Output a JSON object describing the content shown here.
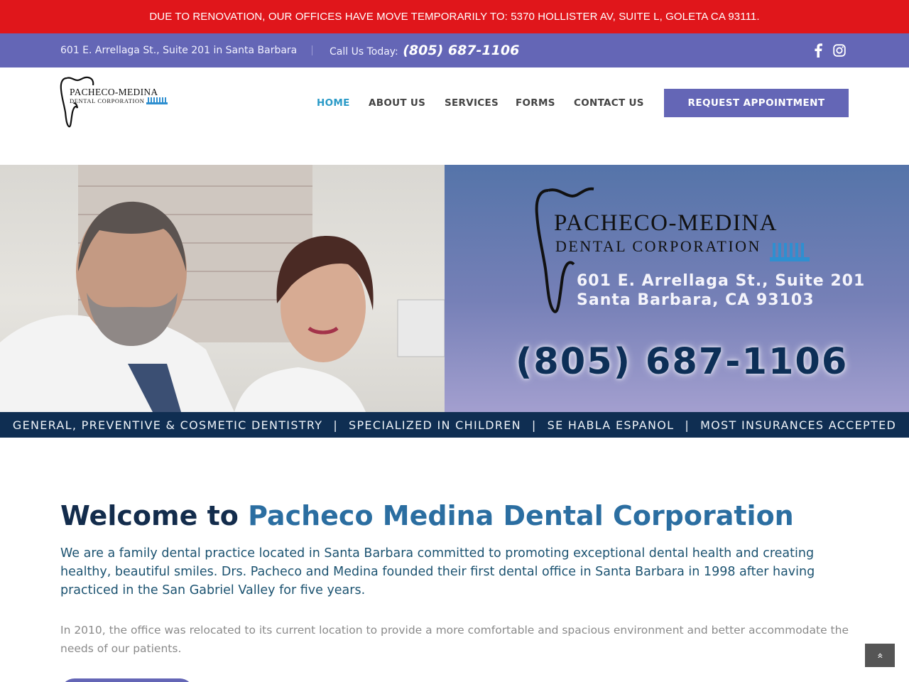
{
  "alert": {
    "text": "DUE TO RENOVATION, OUR OFFICES HAVE MOVE TEMPORARILY TO: 5370 HOLLISTER AV, SUITE L, GOLETA CA 93111."
  },
  "topbar": {
    "address": "601 E. Arrellaga St., Suite 201 in Santa Barbara",
    "call_label": "Call Us Today:",
    "phone": "(805) 687-1106",
    "social": [
      "facebook-icon",
      "instagram-icon"
    ]
  },
  "header": {
    "logo_title": "PACHECO-MEDINA",
    "logo_subtitle": "DENTAL CORPORATION",
    "nav": [
      {
        "label": "HOME",
        "active": true
      },
      {
        "label": "ABOUT US",
        "active": false
      },
      {
        "label": "SERVICES",
        "active": false
      },
      {
        "label": "FORMS",
        "active": false
      },
      {
        "label": "CONTACT US",
        "active": false
      }
    ],
    "cta_label": "REQUEST APPOINTMENT"
  },
  "hero": {
    "brand_title": "PACHECO-MEDINA",
    "brand_subtitle": "DENTAL CORPORATION",
    "address_line1": "601 E. Arrellaga St., Suite 201",
    "address_line2": "Santa Barbara, CA 93103",
    "phone": "(805) 687-1106"
  },
  "services_strip": {
    "items": [
      "GENERAL, PREVENTIVE & COSMETIC DENTISTRY",
      "SPECIALIZED IN CHILDREN",
      "SE HABLA ESPANOL",
      "MOST INSURANCES ACCEPTED"
    ],
    "separator": "|"
  },
  "main": {
    "welcome_bold": "Welcome to",
    "welcome_light": "Pacheco Medina Dental Corporation",
    "intro": "We are a family dental practice located in Santa Barbara committed to promoting exceptional dental health and creating healthy, beautiful smiles. Drs. Pacheco and Medina founded their first dental office in Santa Barbara in 1998 after having practiced in the San Gabriel Valley for five years.",
    "paragraph": "In 2010, the office was relocated to its current location to provide a more comfortable and spacious environment and better accommodate the needs of our patients."
  },
  "colors": {
    "alert_red": "#e0161b",
    "brand_purple": "#6466b6",
    "nav_active": "#2a9ac7",
    "navy": "#0f2e52",
    "heading_dark": "#132c4c",
    "heading_blue": "#2b6ea1"
  },
  "back_to_top": "»"
}
